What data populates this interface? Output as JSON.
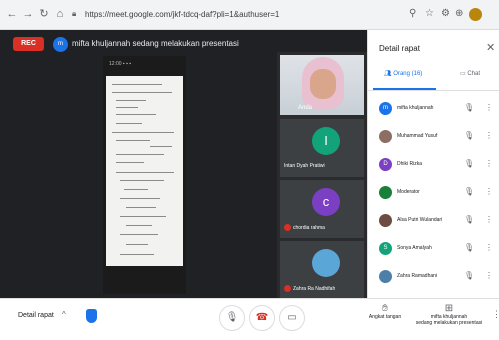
{
  "browser": {
    "back": "←",
    "forward": "→",
    "reload": "↻",
    "home": "⌂",
    "url": "https://meet.google.com/jkf-tdcq-daf?pli=1&authuser=1",
    "extensions": [
      "⚲",
      "☆",
      "⚙",
      "⊕"
    ]
  },
  "meet": {
    "rec_label": "REC",
    "presenter_initial": "m",
    "presenting_text": "mifta khuljannah sedang melakukan presentasi",
    "phone_status": "12:00 ▪ ▪ ▪"
  },
  "tiles": {
    "top_name": "Anda",
    "items": [
      {
        "initial": "I",
        "name": "Intan Dyah Pratiwi",
        "color": "#12a37a"
      },
      {
        "initial": "c",
        "name": "chordia rahma",
        "color": "#7b3fc4"
      },
      {
        "initial": "",
        "name": "Zahra Ra Nadhifah",
        "color": "#5aa6d6"
      }
    ]
  },
  "panel": {
    "title": "Detail rapat",
    "close": "✕",
    "tab_people": "Orang (16)",
    "tab_chat": "Chat",
    "participants": [
      {
        "name": "mifta khuljannah",
        "color": "#1a73e8",
        "initial": "m"
      },
      {
        "name": "Muhammad Yusuf",
        "color": "#8d6e63",
        "initial": ""
      },
      {
        "name": "Dhiki Rizka",
        "color": "#7b3fc4",
        "initial": "D"
      },
      {
        "name": "Moderator",
        "color": "#188038",
        "initial": ""
      },
      {
        "name": "Alsa Putri Wulandari",
        "color": "#6d4c41",
        "initial": ""
      },
      {
        "name": "Sonya Amalyah",
        "color": "#12a37a",
        "initial": "S"
      },
      {
        "name": "Zahra Ramadhani",
        "color": "#4e7fa8",
        "initial": ""
      }
    ]
  },
  "bottom": {
    "meeting_details": "Detail rapat",
    "chevron": "^",
    "raise_hand": "Angkat tangan",
    "presenting_line1": "mifta khuljannah",
    "presenting_line2": "sedang melakukan presentasi",
    "more": "⋮"
  },
  "colors": {
    "accent": "#1a73e8",
    "danger": "#d93025",
    "dark": "#202124"
  }
}
